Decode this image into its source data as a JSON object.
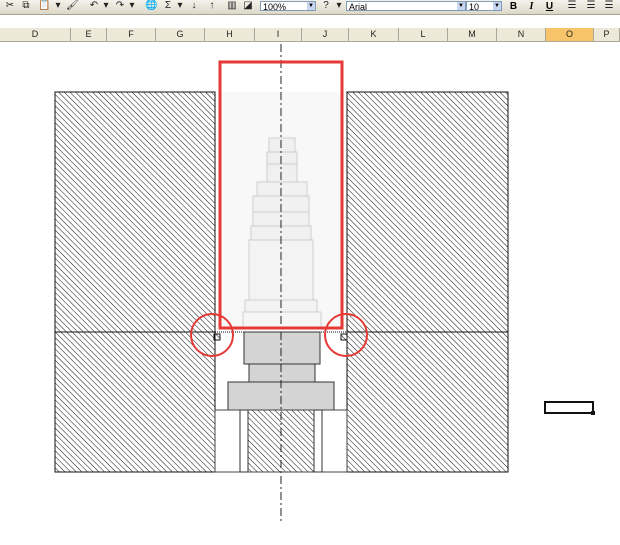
{
  "toolbar": {
    "zoom": "100%",
    "font_name": "Arial",
    "font_size": "10",
    "bold": "B",
    "italic": "I",
    "underline": "U",
    "sum_symbol": "Σ"
  },
  "columns": [
    "D",
    "E",
    "F",
    "G",
    "H",
    "I",
    "J",
    "K",
    "L",
    "M",
    "N",
    "O",
    "P"
  ],
  "selected_column": "O",
  "icons": [
    "cut-icon",
    "copy-icon",
    "paste-icon",
    "format-painter-icon",
    "undo-icon",
    "redo-icon",
    "hyperlink-icon",
    "autosum-icon",
    "sort-ascending-icon",
    "sort-descending-icon",
    "chart-wizard-icon",
    "drawing-icon",
    "help-icon",
    "align-left-icon",
    "align-center-icon",
    "align-right-icon"
  ],
  "colors": {
    "highlight": "#e53935",
    "hatch": "#111111",
    "toolbar_bg": "#ece9d8",
    "selected_header": "#f7c46a"
  }
}
